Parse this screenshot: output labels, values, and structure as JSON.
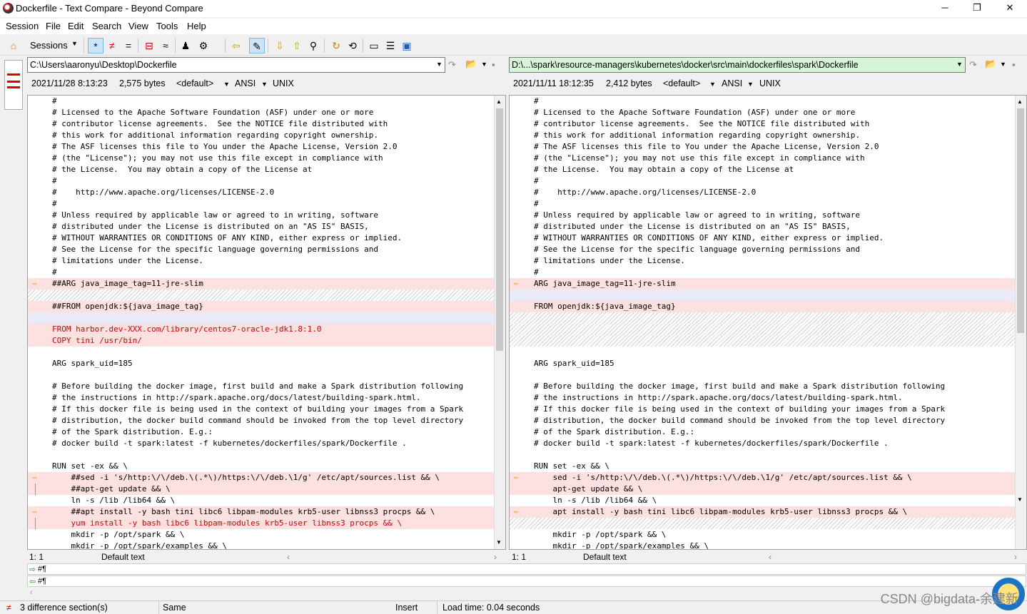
{
  "window": {
    "title": "Dockerfile - Text Compare - Beyond Compare",
    "minimize": "─",
    "maximize": "❐",
    "close": "✕"
  },
  "menu": [
    "Session",
    "File",
    "Edit",
    "Search",
    "View",
    "Tools",
    "Help"
  ],
  "toolbar": {
    "sessions": "Sessions"
  },
  "left": {
    "path": "C:\\Users\\aaronyu\\Desktop\\Dockerfile",
    "date": "2021/11/28 8:13:23",
    "size": "2,575 bytes",
    "format": "<default>",
    "encoding": "ANSI",
    "eol": "UNIX",
    "pos": "1: 1",
    "style": "Default text"
  },
  "right": {
    "path": "D:\\...\\spark\\resource-managers\\kubernetes\\docker\\src\\main\\dockerfiles\\spark\\Dockerfile",
    "date": "2021/11/11 18:12:35",
    "size": "2,412 bytes",
    "format": "<default>",
    "encoding": "ANSI",
    "eol": "UNIX",
    "pos": "1: 1",
    "style": "Default text"
  },
  "left_lines": [
    {
      "t": "#",
      "k": "n"
    },
    {
      "t": "# Licensed to the Apache Software Foundation (ASF) under one or more",
      "k": "n"
    },
    {
      "t": "# contributor license agreements.  See the NOTICE file distributed with",
      "k": "n"
    },
    {
      "t": "# this work for additional information regarding copyright ownership.",
      "k": "n"
    },
    {
      "t": "# The ASF licenses this file to You under the Apache License, Version 2.0",
      "k": "n"
    },
    {
      "t": "# (the \"License\"); you may not use this file except in compliance with",
      "k": "n"
    },
    {
      "t": "# the License.  You may obtain a copy of the License at",
      "k": "n"
    },
    {
      "t": "#",
      "k": "n"
    },
    {
      "t": "#    http://www.apache.org/licenses/LICENSE-2.0",
      "k": "n"
    },
    {
      "t": "#",
      "k": "n"
    },
    {
      "t": "# Unless required by applicable law or agreed to in writing, software",
      "k": "n"
    },
    {
      "t": "# distributed under the License is distributed on an \"AS IS\" BASIS,",
      "k": "n"
    },
    {
      "t": "# WITHOUT WARRANTIES OR CONDITIONS OF ANY KIND, either express or implied.",
      "k": "n"
    },
    {
      "t": "# See the License for the specific language governing permissions and",
      "k": "n"
    },
    {
      "t": "# limitations under the License.",
      "k": "n"
    },
    {
      "t": "#",
      "k": "n"
    },
    {
      "t": "##ARG java_image_tag=11-jre-slim",
      "k": "d",
      "a": true
    },
    {
      "t": "",
      "k": "h"
    },
    {
      "t": "##FROM openjdk:${java_image_tag}",
      "k": "d"
    },
    {
      "t": "",
      "k": "b"
    },
    {
      "t": "FROM harbor.dev-XXX.com/library/centos7-oracle-jdk1.8:1.0",
      "k": "r"
    },
    {
      "t": "COPY tini /usr/bin/",
      "k": "r"
    },
    {
      "t": "",
      "k": "n"
    },
    {
      "t": "ARG spark_uid=185",
      "k": "n"
    },
    {
      "t": "",
      "k": "n"
    },
    {
      "t": "# Before building the docker image, first build and make a Spark distribution following",
      "k": "n"
    },
    {
      "t": "# the instructions in http://spark.apache.org/docs/latest/building-spark.html.",
      "k": "n"
    },
    {
      "t": "# If this docker file is being used in the context of building your images from a Spark",
      "k": "n"
    },
    {
      "t": "# distribution, the docker build command should be invoked from the top level directory",
      "k": "n"
    },
    {
      "t": "# of the Spark distribution. E.g.:",
      "k": "n"
    },
    {
      "t": "# docker build -t spark:latest -f kubernetes/dockerfiles/spark/Dockerfile .",
      "k": "n"
    },
    {
      "t": "",
      "k": "n"
    },
    {
      "t": "RUN set -ex && \\",
      "k": "n"
    },
    {
      "t": "    ##sed -i 's/http:\\/\\/deb.\\(.*\\)/https:\\/\\/deb.\\1/g' /etc/apt/sources.list && \\",
      "k": "d",
      "a": true
    },
    {
      "t": "    ##apt-get update && \\",
      "k": "d",
      "br": true
    },
    {
      "t": "    ln -s /lib /lib64 && \\",
      "k": "n"
    },
    {
      "t": "    ##apt install -y bash tini libc6 libpam-modules krb5-user libnss3 procps && \\",
      "k": "d",
      "a": true
    },
    {
      "t": "    yum install -y bash libc6 libpam-modules krb5-user libnss3 procps && \\",
      "k": "r",
      "br": true
    },
    {
      "t": "    mkdir -p /opt/spark && \\",
      "k": "n"
    },
    {
      "t": "    mkdir -p /opt/spark/examples && \\",
      "k": "n"
    }
  ],
  "right_lines": [
    {
      "t": "#",
      "k": "n"
    },
    {
      "t": "# Licensed to the Apache Software Foundation (ASF) under one or more",
      "k": "n"
    },
    {
      "t": "# contributor license agreements.  See the NOTICE file distributed with",
      "k": "n"
    },
    {
      "t": "# this work for additional information regarding copyright ownership.",
      "k": "n"
    },
    {
      "t": "# The ASF licenses this file to You under the Apache License, Version 2.0",
      "k": "n"
    },
    {
      "t": "# (the \"License\"); you may not use this file except in compliance with",
      "k": "n"
    },
    {
      "t": "# the License.  You may obtain a copy of the License at",
      "k": "n"
    },
    {
      "t": "#",
      "k": "n"
    },
    {
      "t": "#    http://www.apache.org/licenses/LICENSE-2.0",
      "k": "n"
    },
    {
      "t": "#",
      "k": "n"
    },
    {
      "t": "# Unless required by applicable law or agreed to in writing, software",
      "k": "n"
    },
    {
      "t": "# distributed under the License is distributed on an \"AS IS\" BASIS,",
      "k": "n"
    },
    {
      "t": "# WITHOUT WARRANTIES OR CONDITIONS OF ANY KIND, either express or implied.",
      "k": "n"
    },
    {
      "t": "# See the License for the specific language governing permissions and",
      "k": "n"
    },
    {
      "t": "# limitations under the License.",
      "k": "n"
    },
    {
      "t": "#",
      "k": "n"
    },
    {
      "t": "ARG java_image_tag=11-jre-slim",
      "k": "d",
      "a": true
    },
    {
      "t": "",
      "k": "b"
    },
    {
      "t": "FROM openjdk:${java_image_tag}",
      "k": "d"
    },
    {
      "t": "",
      "k": "h"
    },
    {
      "t": "",
      "k": "h"
    },
    {
      "t": "",
      "k": "h"
    },
    {
      "t": "",
      "k": "n"
    },
    {
      "t": "ARG spark_uid=185",
      "k": "n"
    },
    {
      "t": "",
      "k": "n"
    },
    {
      "t": "# Before building the docker image, first build and make a Spark distribution following",
      "k": "n"
    },
    {
      "t": "# the instructions in http://spark.apache.org/docs/latest/building-spark.html.",
      "k": "n"
    },
    {
      "t": "# If this docker file is being used in the context of building your images from a Spark",
      "k": "n"
    },
    {
      "t": "# distribution, the docker build command should be invoked from the top level directory",
      "k": "n"
    },
    {
      "t": "# of the Spark distribution. E.g.:",
      "k": "n"
    },
    {
      "t": "# docker build -t spark:latest -f kubernetes/dockerfiles/spark/Dockerfile .",
      "k": "n"
    },
    {
      "t": "",
      "k": "n"
    },
    {
      "t": "RUN set -ex && \\",
      "k": "n"
    },
    {
      "t": "    sed -i 's/http:\\/\\/deb.\\(.*\\)/https:\\/\\/deb.\\1/g' /etc/apt/sources.list && \\",
      "k": "d",
      "a": true
    },
    {
      "t": "    apt-get update && \\",
      "k": "d"
    },
    {
      "t": "    ln -s /lib /lib64 && \\",
      "k": "n"
    },
    {
      "t": "    apt install -y bash tini libc6 libpam-modules krb5-user libnss3 procps && \\",
      "k": "d",
      "a": true
    },
    {
      "t": "",
      "k": "h"
    },
    {
      "t": "    mkdir -p /opt/spark && \\",
      "k": "n"
    },
    {
      "t": "    mkdir -p /opt/spark/examples && \\",
      "k": "n"
    }
  ],
  "bottom": {
    "line1": "#¶",
    "line2": "#¶"
  },
  "statusbar": {
    "diffs": "3 difference section(s)",
    "same": "Same",
    "mode": "Insert",
    "load": "Load time: 0.04 seconds"
  },
  "watermark": "CSDN @bigdata-余建新"
}
